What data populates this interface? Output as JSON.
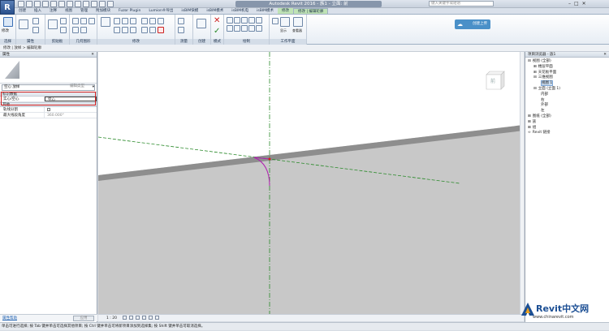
{
  "app": {
    "logo_letter": "R",
    "window_title": "Autodesk Revit 2016 -  族1 - 立面: 前",
    "search_placeholder": "键入关键字或短语",
    "win_controls": [
      "–",
      "□",
      "✕"
    ]
  },
  "ribbon": {
    "tabs": [
      "创建",
      "插入",
      "注释",
      "视图",
      "管理",
      "附加模块",
      "Fuzor Plugin",
      "Lumion®导出",
      "isBIM快模",
      "isBIM模术",
      "isBIM机电",
      "isBIM模术",
      "修改",
      "修改 | 编辑轮廓"
    ],
    "active_tab": "修改 | 编辑轮廓",
    "panels": [
      "选择",
      "属性",
      "剪贴板",
      "几何图形",
      "修改",
      "测量",
      "创建",
      "模式",
      "绘制",
      "工作平面"
    ],
    "modify_label": "修改",
    "cloud_button": "创建上传",
    "workplane_labels": [
      "显示",
      "查看器"
    ]
  },
  "options_bar": {
    "breadcrumb": "修改 | 放样 > 编辑轮廓"
  },
  "properties": {
    "header": "属性",
    "type_selector": "空心 放样",
    "edit_type": "编辑类型",
    "groups": [
      {
        "name": "标识数据",
        "rows": [
          {
            "key": "实心/空心",
            "value": "空心"
          }
        ]
      },
      {
        "name": "其他",
        "rows": [
          {
            "key": "轨线分割",
            "value": ""
          },
          {
            "key": "最大线段角度",
            "value": "360.000°"
          }
        ]
      }
    ],
    "help_link": "属性帮助",
    "apply": "应用"
  },
  "view_bar": {
    "scale": "1 : 20"
  },
  "view_cube": {
    "face": "前"
  },
  "project_browser": {
    "header": "项目浏览器 - 族1",
    "items": [
      {
        "label": "视图 (全部)",
        "indent": 0,
        "toggle": "⊟"
      },
      {
        "label": "楼层平面",
        "indent": 1,
        "toggle": "⊞"
      },
      {
        "label": "天花板平面",
        "indent": 1,
        "toggle": "⊞"
      },
      {
        "label": "三维视图",
        "indent": 1,
        "toggle": "⊟"
      },
      {
        "label": "视图 1",
        "indent": 2,
        "toggle": "",
        "selected": true
      },
      {
        "label": "立面 (立面 1)",
        "indent": 1,
        "toggle": "⊟"
      },
      {
        "label": "内部",
        "indent": 2,
        "toggle": ""
      },
      {
        "label": "右",
        "indent": 2,
        "toggle": ""
      },
      {
        "label": "外部",
        "indent": 2,
        "toggle": ""
      },
      {
        "label": "左",
        "indent": 2,
        "toggle": ""
      },
      {
        "label": "图纸 (全部)",
        "indent": 0,
        "toggle": "⊞"
      },
      {
        "label": "族",
        "indent": 0,
        "toggle": "⊞"
      },
      {
        "label": "组",
        "indent": 0,
        "toggle": "⊞"
      },
      {
        "label": "Revit 链接",
        "indent": 0,
        "toggle": "∞"
      }
    ]
  },
  "status_bar": {
    "text": "单击可进行选择; 按 Tab 键并单击可选择其他项目; 按 Ctrl 键并单击可将新项目添加到选择集; 按 Shift 键并单击可取消选择。"
  },
  "watermark": {
    "brand": "Revit中文网",
    "url": "www.chinarevit.com"
  },
  "colors": {
    "accent": "#4a90c8",
    "highlight_box": "#d02020",
    "sketch_line": "#b020b0",
    "ref_plane": "#2a8a2a"
  }
}
